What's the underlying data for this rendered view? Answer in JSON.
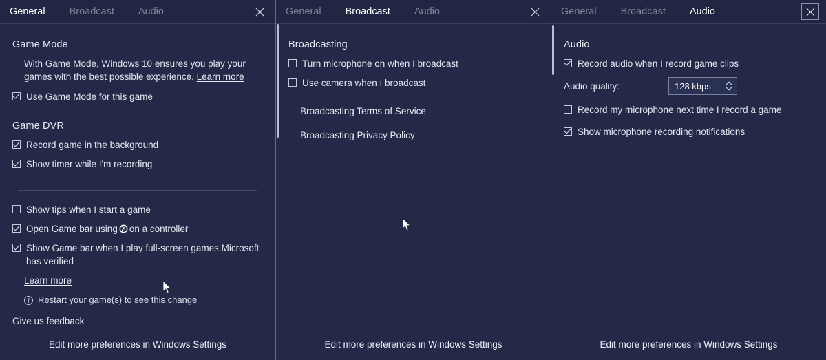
{
  "tabs": {
    "general": "General",
    "broadcast": "Broadcast",
    "audio": "Audio"
  },
  "footer_label": "Edit more preferences in Windows Settings",
  "panel_general": {
    "active_tab": "General",
    "close_icon": "close-icon",
    "game_mode": {
      "heading": "Game Mode",
      "description": "With Game Mode, Windows 10 ensures you play your games with the best possible experience.",
      "learn_more": "Learn more",
      "checkbox": {
        "label": "Use Game Mode for this game",
        "checked": true
      }
    },
    "game_dvr": {
      "heading": "Game DVR",
      "checkboxes": [
        {
          "label": "Record game in the background",
          "checked": true
        },
        {
          "label": "Show timer while I'm recording",
          "checked": true
        }
      ]
    },
    "misc": {
      "checkboxes": [
        {
          "label": "Show tips when I start a game",
          "checked": false
        },
        {
          "label_before": "Open Game bar using",
          "icon": "xbox-logo-icon",
          "label_after": "on a controller",
          "checked": true
        },
        {
          "label": "Show Game bar when I play full-screen games Microsoft has verified",
          "checked": true
        }
      ],
      "learn_more": "Learn more",
      "note": "Restart your game(s) to see this change",
      "note_icon": "info-icon"
    },
    "feedback": {
      "prefix": "Give us ",
      "link": "feedback"
    }
  },
  "panel_broadcast": {
    "active_tab": "Broadcast",
    "close_icon": "close-icon",
    "heading": "Broadcasting",
    "checkboxes": [
      {
        "label": "Turn microphone on when I broadcast",
        "checked": false
      },
      {
        "label": "Use camera when I broadcast",
        "checked": false
      }
    ],
    "links": [
      "Broadcasting Terms of Service",
      "Broadcasting Privacy Policy"
    ]
  },
  "panel_audio": {
    "active_tab": "Audio",
    "close_icon": "close-icon-focused",
    "heading": "Audio",
    "checkbox_record": {
      "label": "Record audio when I record game clips",
      "checked": true
    },
    "quality": {
      "label": "Audio quality:",
      "value": "128 kbps",
      "spinner_icon": "spinner-arrows-icon"
    },
    "checkboxes": [
      {
        "label": "Record my microphone next time I record a game",
        "checked": false
      },
      {
        "label": "Show microphone recording notifications",
        "checked": true
      }
    ]
  },
  "colors": {
    "panel_bg": "#232946",
    "header_bg": "#212742",
    "accent_separator": "#4a6fb0",
    "text_primary": "#e4e7f2",
    "text_inactive_tab": "#7d8499"
  }
}
